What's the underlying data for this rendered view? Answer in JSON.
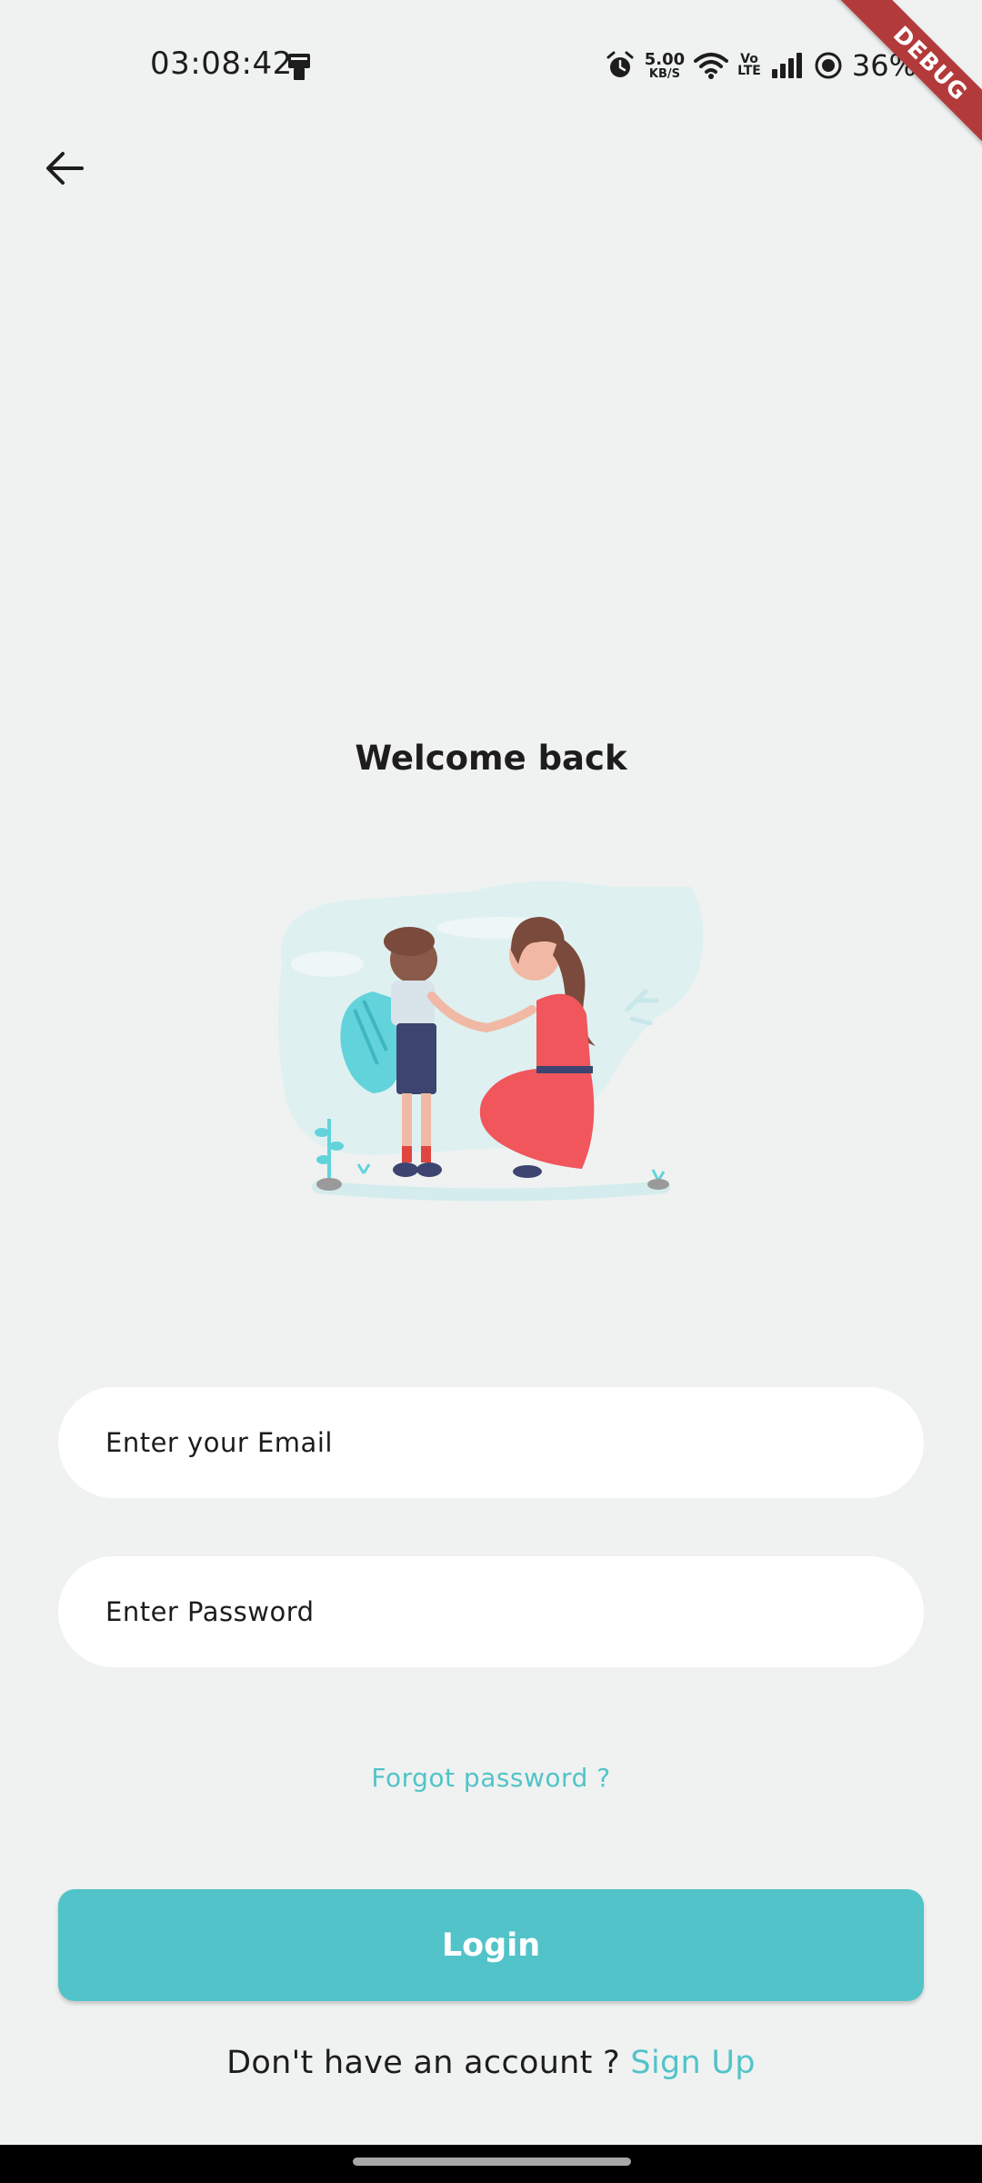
{
  "status_bar": {
    "time": "03:08:42",
    "net_speed_value": "5.00",
    "net_speed_unit": "KB/S",
    "volte_top": "Vo",
    "volte_bottom": "LTE",
    "battery": "36%",
    "icons": [
      "payment-icon",
      "alarm-icon",
      "wifi-icon",
      "volte-icon",
      "signal-icon",
      "battery-saver-icon"
    ]
  },
  "debug_banner": "DEBUG",
  "header": {
    "back_icon": "arrow-left-icon"
  },
  "title": "Welcome back",
  "illustration": "parent-child-illustration",
  "form": {
    "email_placeholder": "Enter your Email",
    "email_value": "",
    "password_placeholder": "Enter Password",
    "password_value": ""
  },
  "forgot_password": "Forgot password ?",
  "login_label": "Login",
  "signup": {
    "prompt": "Don't have an account ? ",
    "link": "Sign Up"
  },
  "colors": {
    "background": "#eff2f1",
    "accent": "#52c3c9",
    "text": "#1d1d1d",
    "debug": "#b33a3a"
  }
}
